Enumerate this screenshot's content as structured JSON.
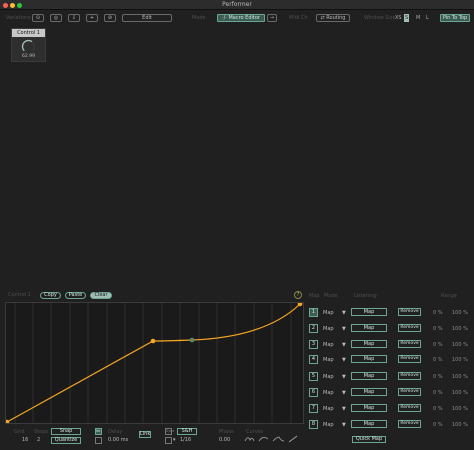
{
  "window": {
    "title": "Performer"
  },
  "toolbar": {
    "variations_label": "Variations",
    "var_buttons": [
      "⊙",
      "◎",
      "⇩",
      "+",
      "⊘"
    ],
    "edit_label": "Edit",
    "mode_label": "Mode",
    "macro_editor_label": "·/· Macro Editor",
    "routing_label_left": "Midi Ch",
    "routing_label": "⇄ Routing",
    "window_size_label": "Window Size",
    "sizes": [
      "XS",
      "S",
      "M",
      "L"
    ],
    "selected_size": "S",
    "pin_label": "Pin To Top"
  },
  "macro": {
    "name": "Control 1",
    "value": "62.99",
    "fraction": 0.63
  },
  "curve": {
    "label": "Control 1",
    "copy": "Copy",
    "paste": "Paste",
    "clear": "Clear",
    "help": "?"
  },
  "mapping_headers": {
    "map": "Map",
    "mode": "Mode",
    "listening": "Listening",
    "range": "Range"
  },
  "mappings": [
    {
      "num": "1",
      "mode": "Map",
      "map": "Map",
      "remove": "Remove",
      "min": "0 %",
      "max": "100 %"
    },
    {
      "num": "2",
      "mode": "Map",
      "map": "Map",
      "remove": "Remove",
      "min": "0 %",
      "max": "100 %"
    },
    {
      "num": "3",
      "mode": "Map",
      "map": "Map",
      "remove": "Remove",
      "min": "0 %",
      "max": "100 %"
    },
    {
      "num": "4",
      "mode": "Map",
      "map": "Map",
      "remove": "Remove",
      "min": "0 %",
      "max": "100 %"
    },
    {
      "num": "5",
      "mode": "Map",
      "map": "Map",
      "remove": "Remove",
      "min": "0 %",
      "max": "100 %"
    },
    {
      "num": "6",
      "mode": "Map",
      "map": "Map",
      "remove": "Remove",
      "min": "0 %",
      "max": "100 %"
    },
    {
      "num": "7",
      "mode": "Map",
      "map": "Map",
      "remove": "Remove",
      "min": "0 %",
      "max": "100 %"
    },
    {
      "num": "8",
      "mode": "Map",
      "map": "Map",
      "remove": "Remove",
      "min": "0 %",
      "max": "100 %"
    }
  ],
  "quick_map": "Quick Map",
  "bottom": {
    "grid_label": "Grid",
    "steps_label": "Steps",
    "grid_value": "16",
    "steps_value": "2",
    "snap": "Snap",
    "quantize": "Quantize",
    "lfo_label": "lfo",
    "delay_label": "Delay",
    "delay_value": "0.00 ms",
    "link": "Link",
    "sync_label": "Sync",
    "sh_label": "S&H",
    "rate_value": "1/16",
    "phase_label": "Phase",
    "phase_value": "0.00",
    "curves_label": "Curves"
  },
  "colors": {
    "accent": "#f5a623",
    "teal": "#6aa595",
    "background": "#202020"
  }
}
